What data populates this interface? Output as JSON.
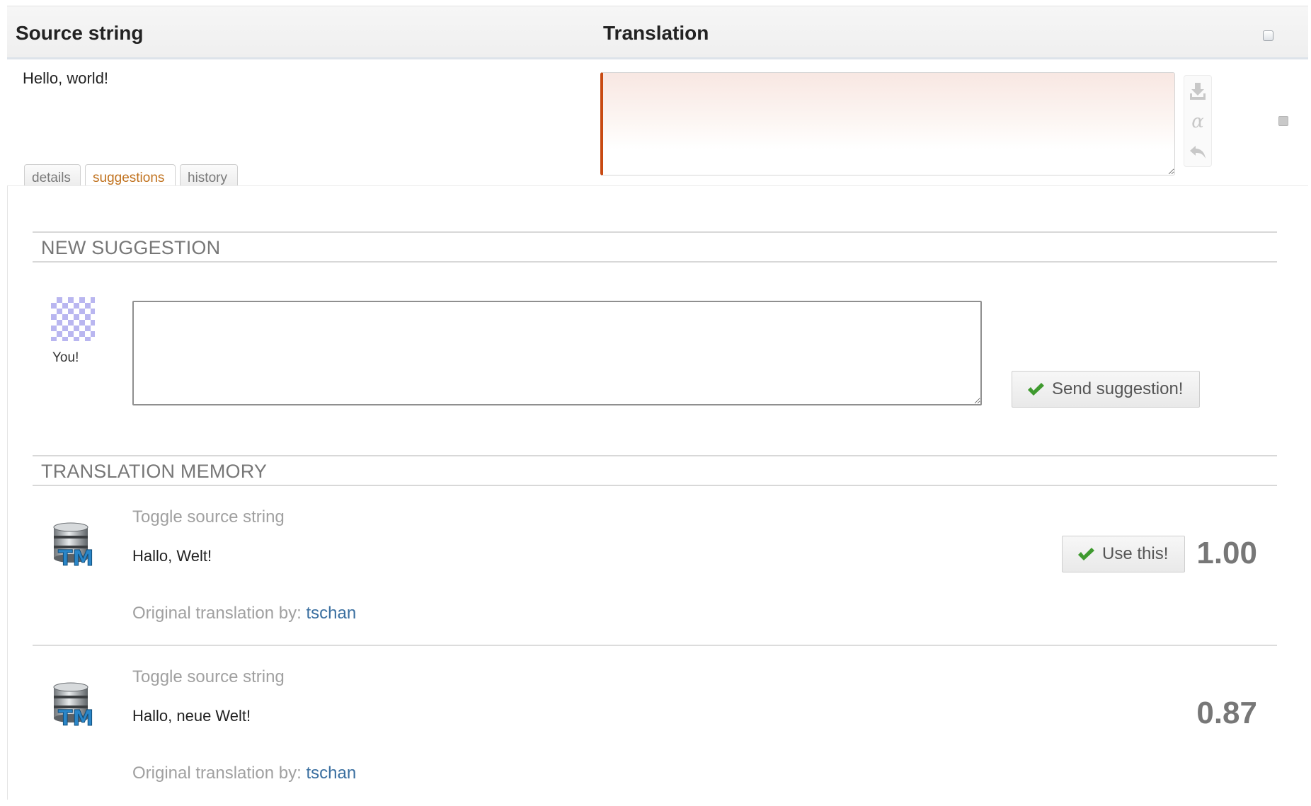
{
  "header": {
    "source_title": "Source string",
    "translation_title": "Translation"
  },
  "unit": {
    "source_text": "Hello, world!",
    "translation_value": "",
    "tabs": [
      {
        "label": "details",
        "active": false
      },
      {
        "label": "suggestions",
        "active": true
      },
      {
        "label": "history",
        "active": false
      }
    ],
    "tools": [
      "copy-source-icon",
      "special-characters-icon",
      "undo-icon"
    ]
  },
  "new_suggestion": {
    "title": "NEW SUGGESTION",
    "user_label": "You!",
    "input_value": "",
    "send_label": "Send suggestion!"
  },
  "translation_memory": {
    "title": "TRANSLATION MEMORY",
    "entries": [
      {
        "toggle_label": "Toggle source string",
        "target": "Hallo, Welt!",
        "credit_prefix": "Original translation by:",
        "user": "tschan",
        "use_label": "Use this!",
        "score": "1.00"
      },
      {
        "toggle_label": "Toggle source string",
        "target": "Hallo, neue Welt!",
        "credit_prefix": "Original translation by:",
        "user": "tschan",
        "score": "0.87"
      }
    ]
  },
  "colors": {
    "accent_orange": "#c84a12",
    "active_tab_text": "#c0711d",
    "check_green": "#3f9a2f",
    "link_blue": "#3a6fa0",
    "avatar_pattern": "#b9b6f0"
  }
}
